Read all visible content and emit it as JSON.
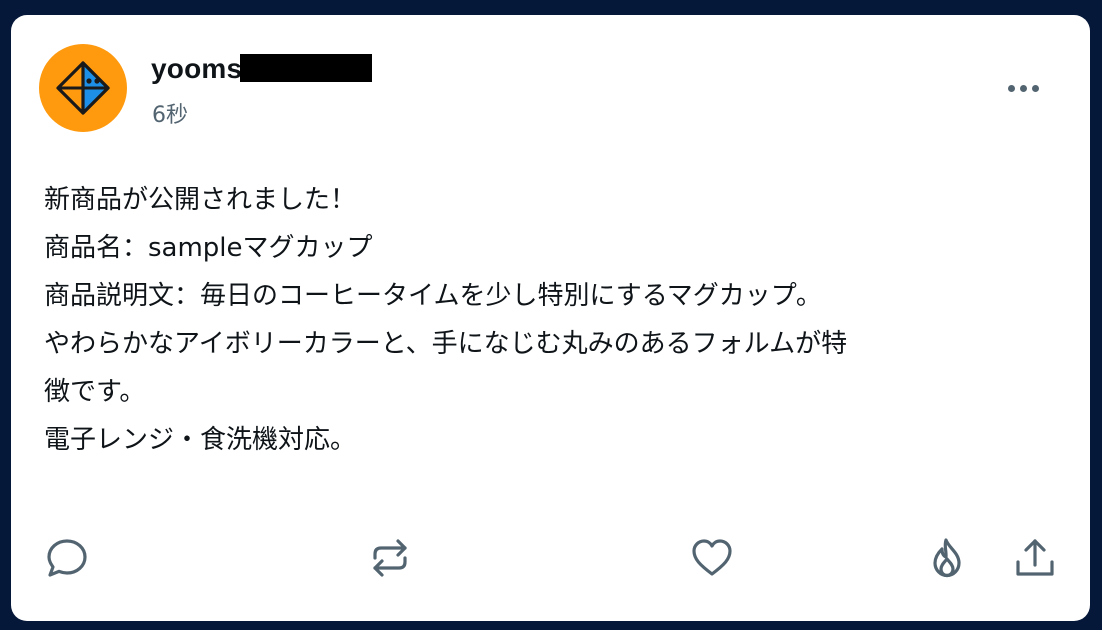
{
  "post": {
    "author": {
      "username": "yooms",
      "avatar_icon": "orange-diamond-logo-icon",
      "avatar_color": "#ff9a0e"
    },
    "timestamp": "6秒",
    "lines": [
      "新商品が公開されました！",
      "商品名：sampleマグカップ",
      "商品説明文：毎日のコーヒータイムを少し特別にするマグカップ。",
      "やわらかなアイボリーカラーと、手になじむ丸みのあるフォルムが特",
      "徴です。",
      "電子レンジ・食洗機対応。"
    ],
    "actions": [
      {
        "name": "reply",
        "icon": "speech-bubble-icon"
      },
      {
        "name": "repost",
        "icon": "repost-arrows-icon"
      },
      {
        "name": "like",
        "icon": "heart-icon"
      },
      {
        "name": "boost",
        "icon": "flame-icon"
      },
      {
        "name": "share",
        "icon": "share-upload-icon"
      }
    ]
  },
  "colors": {
    "background": "#06183a",
    "card": "#ffffff",
    "text": "#0f1419",
    "muted": "#536471"
  }
}
